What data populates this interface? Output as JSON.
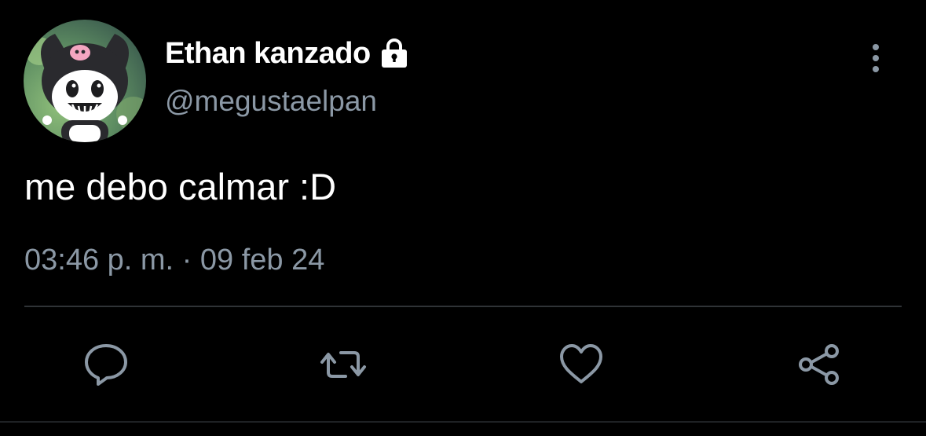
{
  "tweet": {
    "author": {
      "display_name": "Ethan kanzado",
      "handle": "@megustaelpan",
      "protected_icon": "lock-icon",
      "avatar": "kuromi-avatar"
    },
    "text": "me debo calmar :D",
    "timestamp": "03:46 p. m. · 09 feb 24"
  },
  "actions": {
    "reply_icon": "speech-bubble-icon",
    "retweet_icon": "retweet-icon",
    "like_icon": "heart-icon",
    "share_icon": "share-icon",
    "more_icon": "vertical-ellipsis-icon"
  },
  "colors": {
    "background": "#000000",
    "primary_text": "#ffffff",
    "secondary_text": "#8b98a5",
    "divider": "#2f3336"
  }
}
